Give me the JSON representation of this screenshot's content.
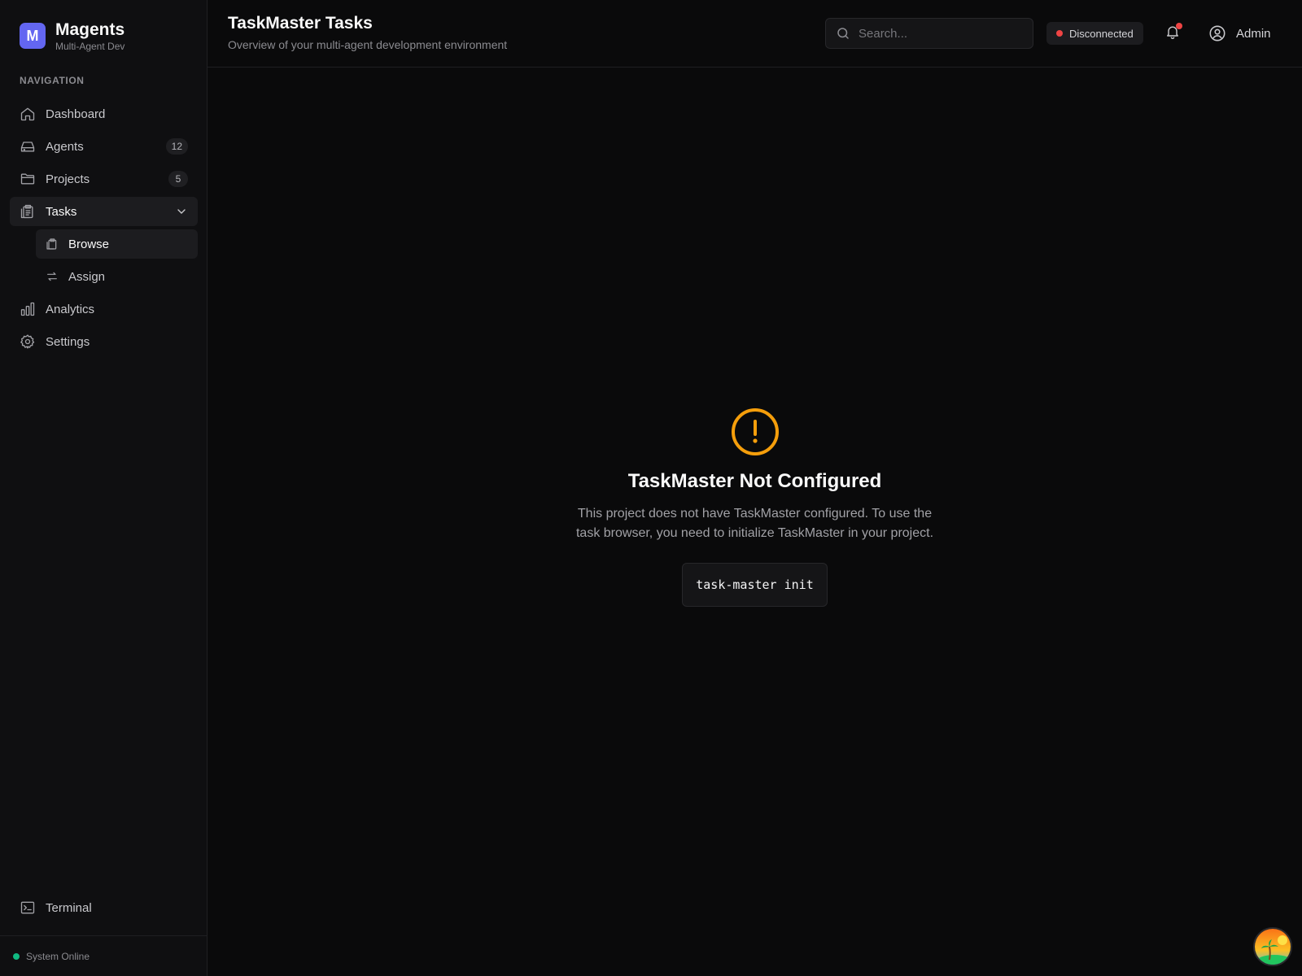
{
  "brand": {
    "logo_letter": "M",
    "name": "Magents",
    "subtitle": "Multi-Agent Dev",
    "logo_color": "#6366f1"
  },
  "sidebar": {
    "section_label": "NAVIGATION",
    "items": [
      {
        "label": "Dashboard",
        "icon": "home-icon"
      },
      {
        "label": "Agents",
        "icon": "server-icon",
        "badge": "12"
      },
      {
        "label": "Projects",
        "icon": "folder-icon",
        "badge": "5"
      },
      {
        "label": "Tasks",
        "icon": "clipboard-icon",
        "expanded": true,
        "children": [
          {
            "label": "Browse",
            "icon": "clipboard-icon",
            "active": true
          },
          {
            "label": "Assign",
            "icon": "arrows-exchange-icon"
          }
        ]
      },
      {
        "label": "Analytics",
        "icon": "bar-chart-icon"
      },
      {
        "label": "Settings",
        "icon": "gear-icon"
      }
    ],
    "terminal_label": "Terminal",
    "system_status": "System Online"
  },
  "header": {
    "title": "TaskMaster Tasks",
    "subtitle": "Overview of your multi-agent development environment",
    "search_placeholder": "Search...",
    "connection_status": "Disconnected",
    "user_label": "Admin"
  },
  "main": {
    "title": "TaskMaster Not Configured",
    "description": "This project does not have TaskMaster configured. To use the task browser, you need to initialize TaskMaster in your project.",
    "command": "task-master init",
    "warning_color": "#f59e0b"
  },
  "colors": {
    "status_online": "#10b981",
    "status_disconnected": "#ef4444",
    "accent": "#6366f1"
  }
}
